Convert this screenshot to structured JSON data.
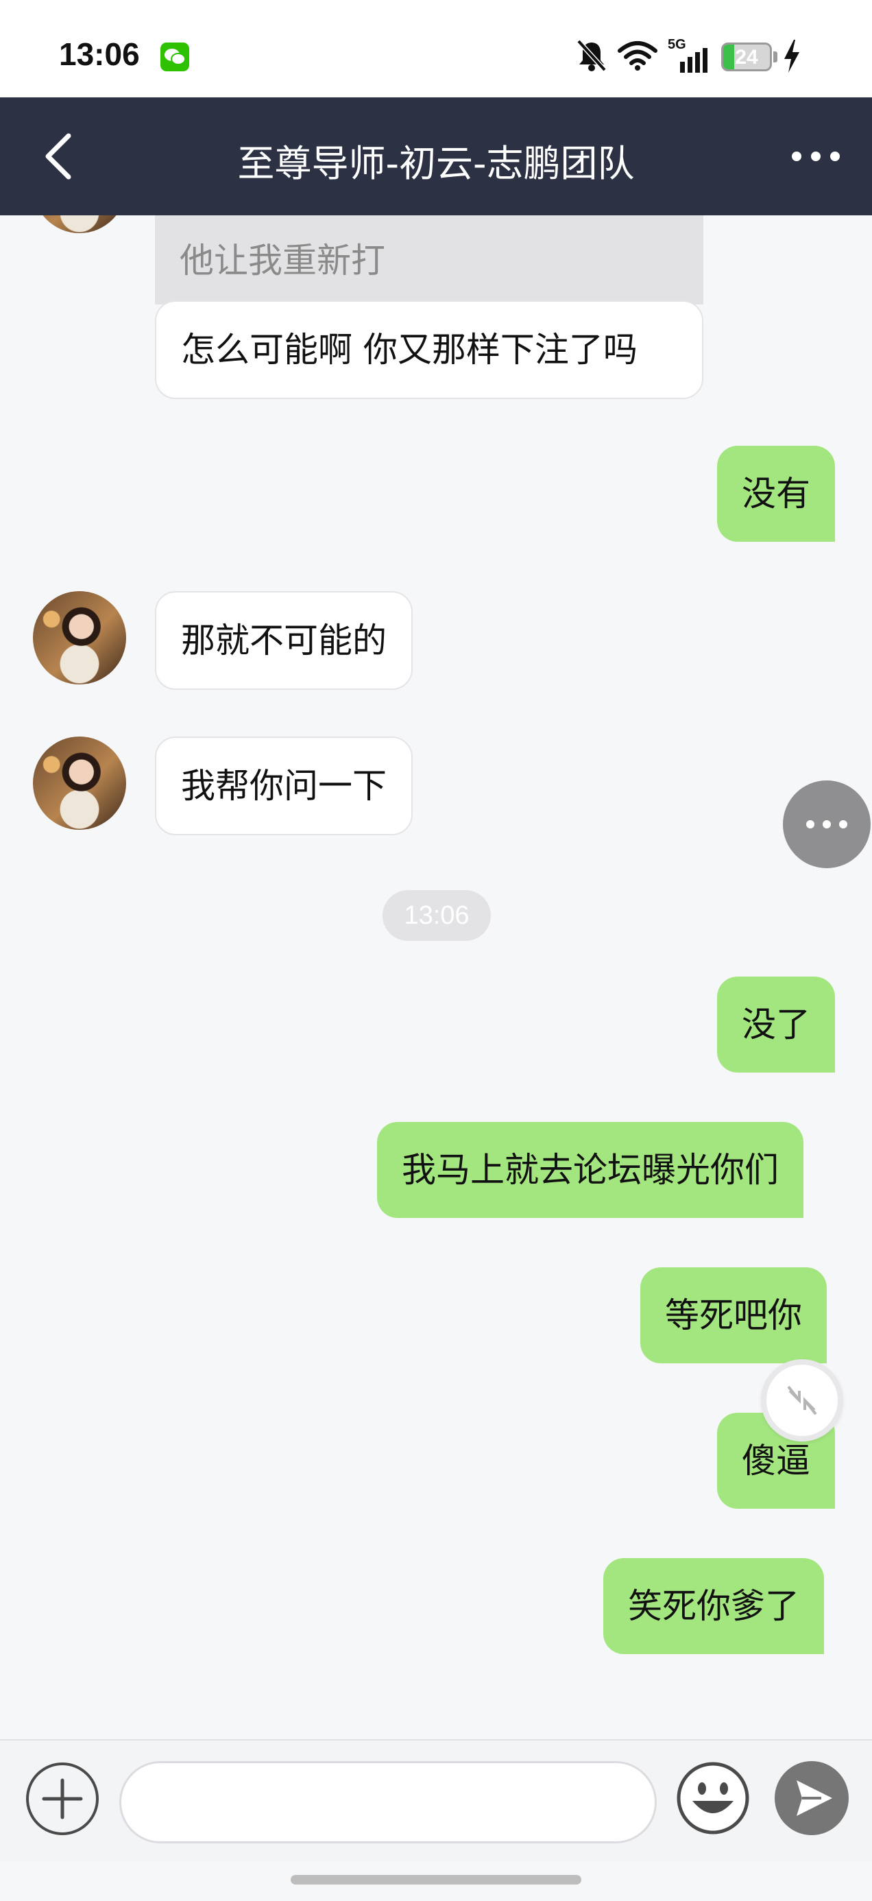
{
  "status_bar": {
    "time": "13:06",
    "network": "5G",
    "battery": "24",
    "battery_level": 0.24,
    "icons": [
      "wechat-icon",
      "mute-bell-icon",
      "wifi-icon",
      "signal-icon",
      "battery-icon",
      "charging-icon"
    ]
  },
  "header": {
    "title": "至尊导师-初云-志鹏团队"
  },
  "messages": {
    "quote_text": "他让我重新打",
    "m1": "怎么可能啊 你又那样下注了吗",
    "m2": "没有",
    "m3": "那就不可能的",
    "m4": "我帮你问一下",
    "time": "13:06",
    "m5": "没了",
    "m6": "我马上就去论坛曝光你们",
    "m7": "等死吧你",
    "m8": "傻逼",
    "m9": "笑死你爹了"
  },
  "input": {
    "value": "",
    "placeholder": ""
  },
  "colors": {
    "header_bg": "#2c3143",
    "outgoing_bubble": "#a3e67f",
    "incoming_bubble": "#ffffff",
    "chat_bg": "#f6f7f9"
  }
}
